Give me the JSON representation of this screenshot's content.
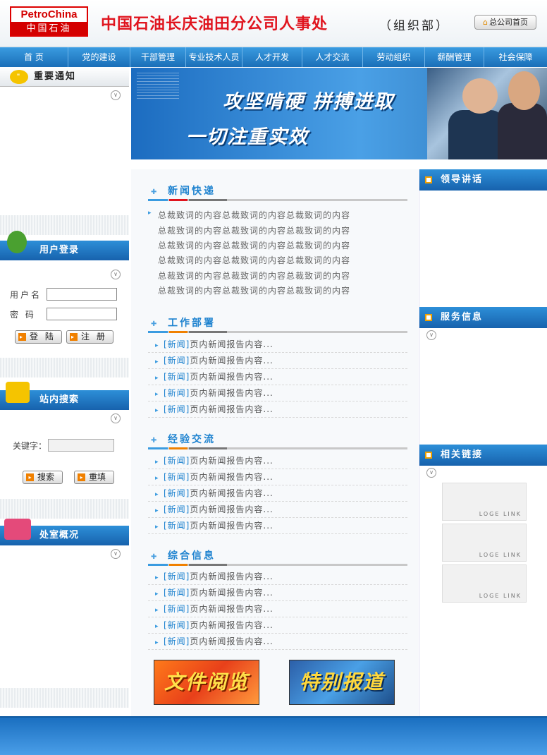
{
  "header": {
    "logo_en": "PetroChina",
    "logo_cn": "中国石油",
    "title": "中国石油长庆油田分公司人事处",
    "subtitle": "（组织部）",
    "home_button": "总公司首页"
  },
  "nav": {
    "items": [
      "首 页",
      "党的建设",
      "干部管理",
      "专业技术人员",
      "人才开发",
      "人才交流",
      "劳动组织",
      "薪酬管理",
      "社会保障"
    ]
  },
  "left": {
    "notice_title": "重要通知",
    "login_title": "用户登录",
    "username_label": "用户名",
    "password_label": "密 码",
    "login_button": "登 陆",
    "register_button": "注 册",
    "search_title": "站内搜索",
    "keyword_label": "关键字：",
    "search_button": "搜索",
    "reset_button": "重填",
    "overview_title": "处室概况"
  },
  "banner": {
    "line1": "攻坚啃硬 拼搏进取",
    "line2": "一切注重实效"
  },
  "center": {
    "news_title": "新闻快递",
    "news_lines": [
      "总裁致词的内容总裁致词的内容总裁致词的内容",
      "总裁致词的内容总裁致词的内容总裁致词的内容",
      "总裁致词的内容总裁致词的内容总裁致词的内容",
      "总裁致词的内容总裁致词的内容总裁致词的内容",
      "总裁致词的内容总裁致词的内容总裁致词的内容",
      "总裁致词的内容总裁致词的内容总裁致词的内容"
    ],
    "work_title": "工作部署",
    "work_items": [
      "页内新闻报告内容...",
      "页内新闻报告内容...",
      "页内新闻报告内容...",
      "页内新闻报告内容...",
      "页内新闻报告内容..."
    ],
    "exp_title": "经验交流",
    "exp_items": [
      "页内新闻报告内容...",
      "页内新闻报告内容...",
      "页内新闻报告内容...",
      "页内新闻报告内容...",
      "页内新闻报告内容..."
    ],
    "info_title": "综合信息",
    "info_items": [
      "页内新闻报告内容...",
      "页内新闻报告内容...",
      "页内新闻报告内容...",
      "页内新闻报告内容...",
      "页内新闻报告内容..."
    ],
    "news_tag": "[新闻]",
    "docs_button": "文件阅览",
    "special_button": "特别报道"
  },
  "right": {
    "speech_title": "领导讲话",
    "service_title": "服务信息",
    "links_title": "相关链接",
    "logo_link": "LOGE LINK"
  },
  "colors": {
    "primary_blue": "#1d82cf",
    "title_red": "#e0141e",
    "accent_orange": "#f08000"
  }
}
